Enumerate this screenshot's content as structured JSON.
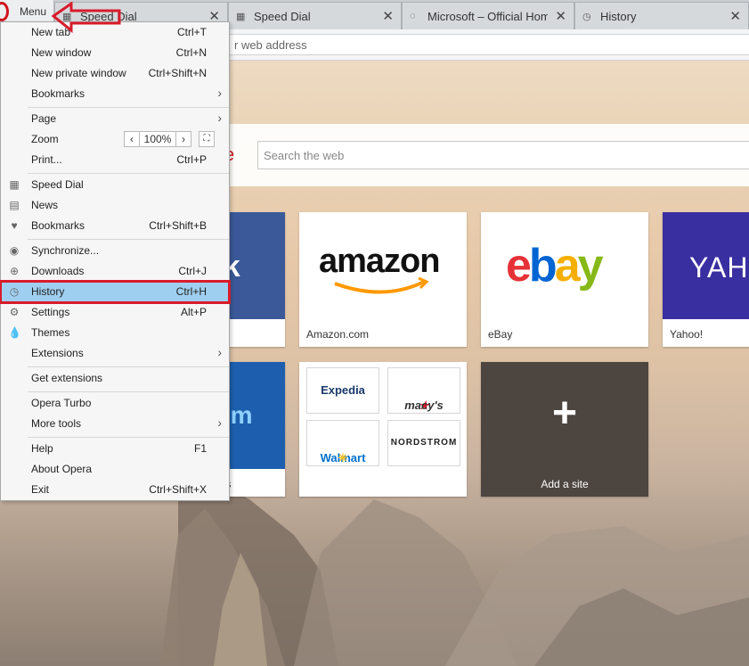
{
  "tabs": [
    {
      "icon": "speed-dial-icon",
      "title": "Speed Dial"
    },
    {
      "icon": "speed-dial-icon",
      "title": "Speed Dial"
    },
    {
      "icon": "loading-icon",
      "title": "Microsoft – Official Home"
    },
    {
      "icon": "clock-icon",
      "title": "History"
    }
  ],
  "menu_button": {
    "label": "Menu"
  },
  "address_bar": {
    "placeholder": "r web address"
  },
  "search": {
    "placeholder": "Search the web"
  },
  "speed_dial": {
    "tiles": [
      {
        "art": "ok",
        "caption": ""
      },
      {
        "art": "amazon",
        "caption": "Amazon.com"
      },
      {
        "art": "ebay",
        "caption": "eBay"
      },
      {
        "art": "YAHO",
        "caption": "Yahoo!"
      },
      {
        "art": "com",
        "caption": "otels"
      },
      {
        "folder": [
          "Expedia",
          "macy's",
          "Walmart",
          "NORDSTROM"
        ]
      },
      {
        "add_label": "Add a site"
      }
    ]
  },
  "menu": {
    "items": [
      {
        "label": "New tab",
        "shortcut": "Ctrl+T"
      },
      {
        "label": "New window",
        "shortcut": "Ctrl+N"
      },
      {
        "label": "New private window",
        "shortcut": "Ctrl+Shift+N"
      },
      {
        "label": "Bookmarks",
        "arrow": "›"
      },
      {
        "label": "Page",
        "arrow": "›"
      },
      {
        "label": "Zoom",
        "zoom": "100%"
      },
      {
        "label": "Print...",
        "shortcut": "Ctrl+P"
      },
      {
        "label": "Speed Dial",
        "icon": "speed-dial-icon"
      },
      {
        "label": "News",
        "icon": "news-icon"
      },
      {
        "label": "Bookmarks",
        "shortcut": "Ctrl+Shift+B",
        "icon": "heart-icon"
      },
      {
        "label": "Synchronize...",
        "icon": "person-icon"
      },
      {
        "label": "Downloads",
        "shortcut": "Ctrl+J",
        "icon": "download-icon"
      },
      {
        "label": "History",
        "shortcut": "Ctrl+H",
        "icon": "clock-icon"
      },
      {
        "label": "Settings",
        "shortcut": "Alt+P",
        "icon": "gear-icon"
      },
      {
        "label": "Themes",
        "icon": "drop-icon"
      },
      {
        "label": "Extensions",
        "arrow": "›"
      },
      {
        "label": "Get extensions"
      },
      {
        "label": "Opera Turbo"
      },
      {
        "label": "More tools",
        "arrow": "›"
      },
      {
        "label": "Help",
        "shortcut": "F1"
      },
      {
        "label": "About Opera"
      },
      {
        "label": "Exit",
        "shortcut": "Ctrl+Shift+X"
      }
    ]
  },
  "colors": {
    "highlight": "#9fcff0",
    "annotation_red": "#d81b2b",
    "opera_red": "#d0121b"
  }
}
